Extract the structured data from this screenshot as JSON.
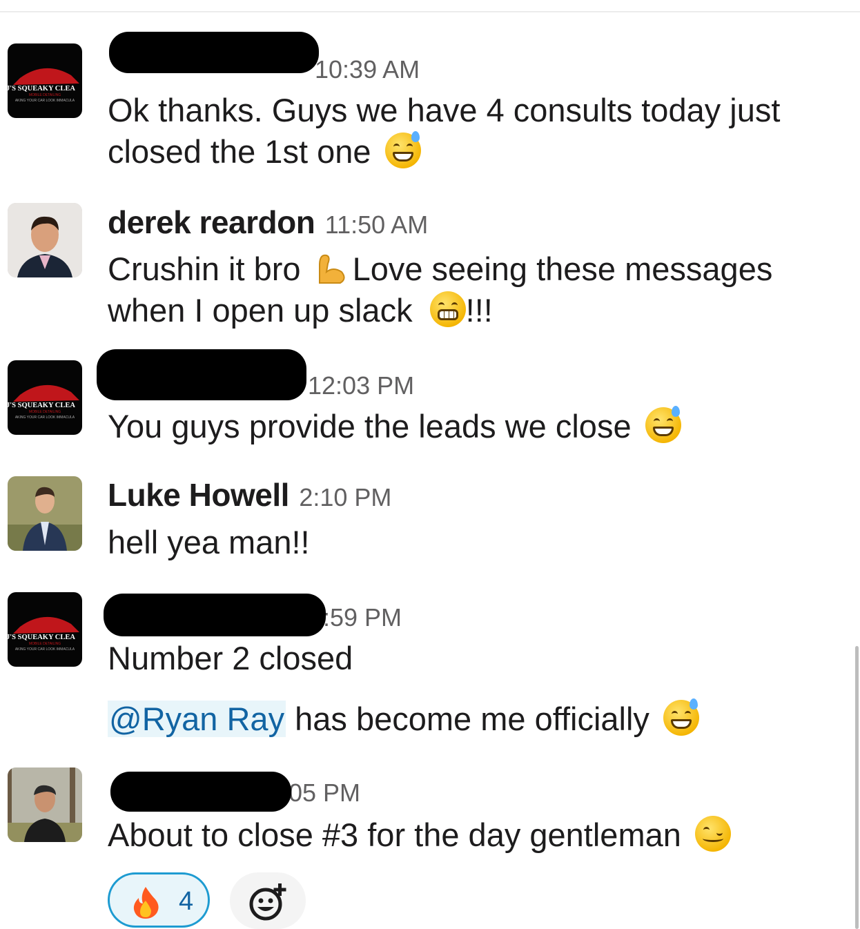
{
  "messages": [
    {
      "author": "",
      "time": "10:39 AM",
      "lines": [
        "Ok thanks. Guys we have 4 consults today just",
        "closed the 1st one"
      ],
      "avatar": "logo",
      "redacted": true
    },
    {
      "author": "derek reardon",
      "time": "11:50 AM",
      "line1a": "Crushin it bro",
      "line1b": "Love seeing these messages",
      "line2a": "when I open up slack",
      "line2b": "!!!",
      "avatar": "photo",
      "redacted": false
    },
    {
      "author": "",
      "time": "12:03 PM",
      "lines": [
        "You guys provide the leads we close"
      ],
      "avatar": "logo",
      "redacted": true
    },
    {
      "author": "Luke Howell",
      "time": "2:10 PM",
      "lines": [
        "hell yea man!!"
      ],
      "avatar": "photo",
      "redacted": false
    },
    {
      "author": "",
      "time": ":59 PM",
      "lines": [
        "Number 2 closed"
      ],
      "mention": "@Ryan Ray",
      "mention_rest": "has become me officially",
      "avatar": "logo",
      "redacted": true
    },
    {
      "author": "",
      "time": "05 PM",
      "lines": [
        "About to close #3 for the day gentleman"
      ],
      "avatar": "photo",
      "redacted": true
    }
  ],
  "logo": {
    "line1": "J'S SQUEAKY CLEA",
    "line2": "MOBILE DETAILING",
    "line3": "AKING YOUR CAR LOOK IMMACULA"
  },
  "reaction": {
    "emoji": "fire-emoji",
    "count": "4"
  },
  "add_reaction": {
    "icon": "add-reaction-icon"
  },
  "colors": {
    "mention_bg": "#e8f5fa",
    "mention_text": "#1264a3",
    "reaction_border": "#1d9bd1",
    "time": "#616061"
  }
}
